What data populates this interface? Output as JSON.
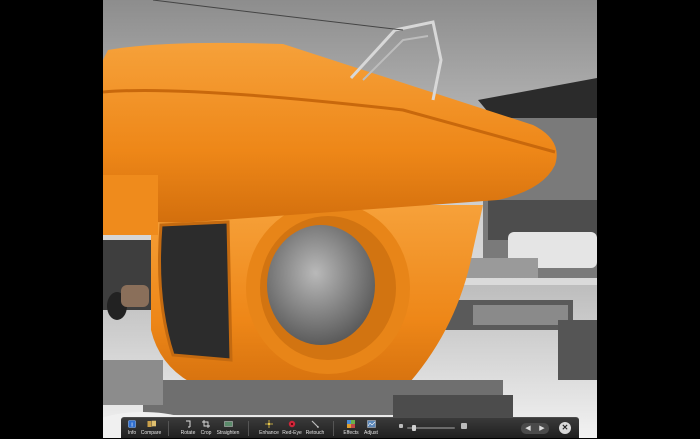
{
  "toolbar": {
    "buttons": [
      {
        "label": "Info",
        "icon": "info-icon"
      },
      {
        "label": "Compare",
        "icon": "compare-icon"
      },
      {
        "label": "Rotate",
        "icon": "rotate-icon"
      },
      {
        "label": "Crop",
        "icon": "crop-icon"
      },
      {
        "label": "Straighten",
        "icon": "straighten-icon"
      },
      {
        "label": "Enhance",
        "icon": "enhance-icon"
      },
      {
        "label": "Red-Eye",
        "icon": "red-eye-icon"
      },
      {
        "label": "Retouch",
        "icon": "retouch-icon"
      },
      {
        "label": "Effects",
        "icon": "effects-icon"
      },
      {
        "label": "Adjust",
        "icon": "adjust-icon"
      }
    ],
    "prev_arrow": "◀",
    "next_arrow": "▶",
    "close": "✕"
  },
  "colors": {
    "boat_orange": "#f08a1e",
    "toolbar_bg": "#2a2a2a",
    "label_text": "#e6e6e6"
  }
}
